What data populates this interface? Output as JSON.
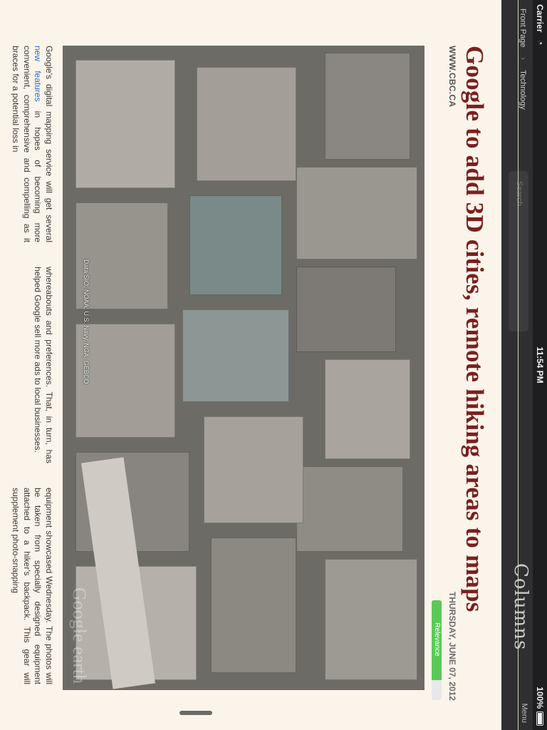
{
  "status": {
    "carrier": "Carrier",
    "time": "11:54 PM",
    "battery": "100%"
  },
  "header": {
    "nav_front": "Front Page",
    "nav_section": "Technology",
    "search_placeholder": "Search",
    "brand": "Columns",
    "menu": "Menu"
  },
  "article": {
    "title": "Google to add 3D cities, remote hiking areas to maps",
    "source": "WWW.CBC.CA",
    "date": "THURSDAY, JUNE 07, 2012",
    "relevance_label": "Relevance",
    "relevance_fraction": 0.8,
    "photo_credits": "Data SIO, NOAA, U.S. Navy, NGA, GEBCO",
    "photo_watermark": "Google earth",
    "col1_before": "Google's digital mapping service will get several ",
    "col1_link": "new features",
    "col1_after": " in hopes of becoming more convenient, comprehensive and compelling as it braces for a potential loss in",
    "col2": "whereabouts and preferences. That, in turn, has helped Google sell more ads to local businesses.",
    "col3": "equipment showcased Wednesday. The photos will be taken from specially designed equipment attached to a hiker's backpack. This gear will supplement photo-snapping"
  },
  "colors": {
    "headline": "#7b1f1f",
    "page_background": "#fbf4ea",
    "relevance_green": "#5cc85a",
    "link": "#2a6fd0"
  }
}
